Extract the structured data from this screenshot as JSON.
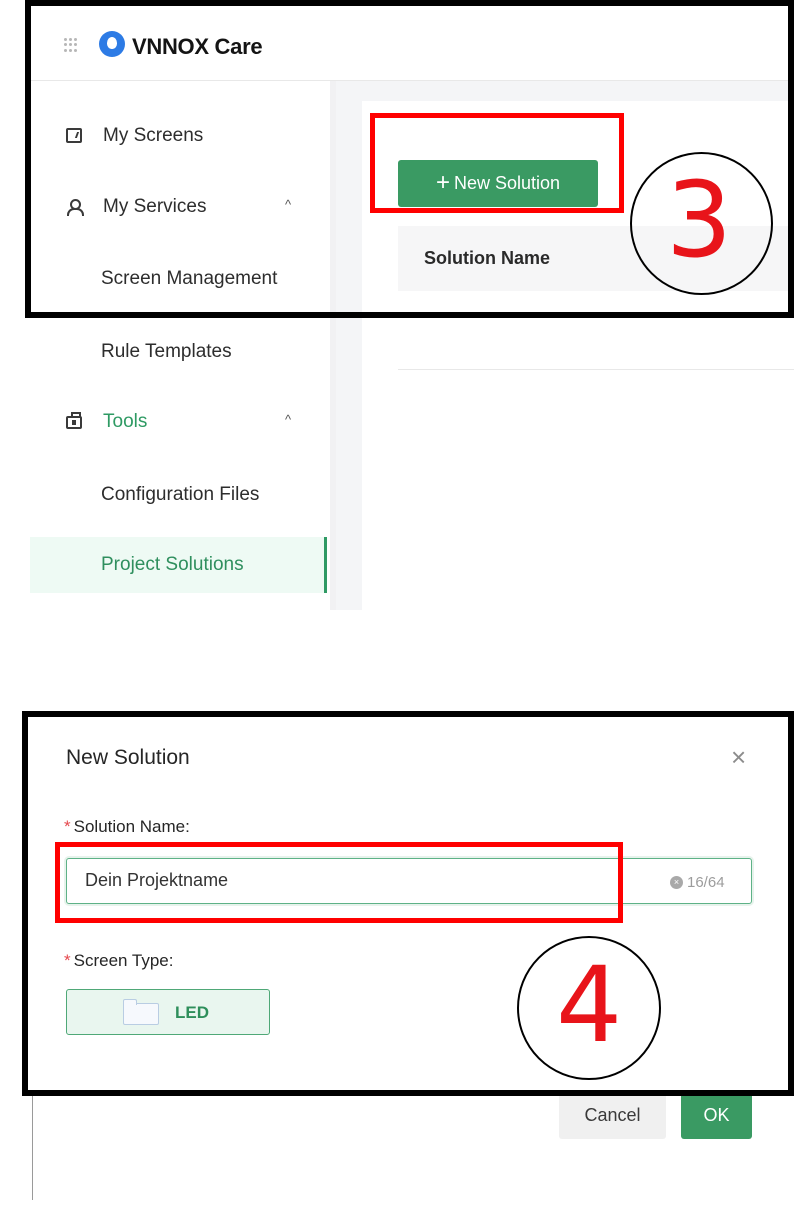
{
  "app": {
    "title": "VNNOX Care"
  },
  "sidebar": {
    "items": [
      {
        "label": "My Screens",
        "icon": "monitor-icon"
      },
      {
        "label": "My Services",
        "icon": "user-icon",
        "chevron": "^"
      },
      {
        "label": "Screen Management"
      },
      {
        "label": "Rule Templates"
      },
      {
        "label": "Tools",
        "icon": "toolbox-icon",
        "chevron": "^"
      },
      {
        "label": "Configuration Files"
      },
      {
        "label": "Project Solutions",
        "active": true
      }
    ]
  },
  "main": {
    "new_button": {
      "plus": "+",
      "label": "New Solution"
    },
    "table_header": {
      "name": "Solution Name"
    }
  },
  "dialog": {
    "title": "New Solution",
    "close": "×",
    "name_field": {
      "required_mark": "*",
      "label": "Solution Name:",
      "value": "Dein Projektname",
      "clear": "×",
      "counter": "16/64"
    },
    "type_field": {
      "required_mark": "*",
      "label": "Screen Type:",
      "option": "LED"
    },
    "cancel": "Cancel",
    "ok": "OK"
  },
  "annotations": {
    "step_3": "3",
    "step_4": "4"
  },
  "colors": {
    "accent_green": "#3a9a63",
    "annotation_red": "#ff0000",
    "required_star": "#e5484d",
    "logo_blue": "#2d7be5"
  }
}
